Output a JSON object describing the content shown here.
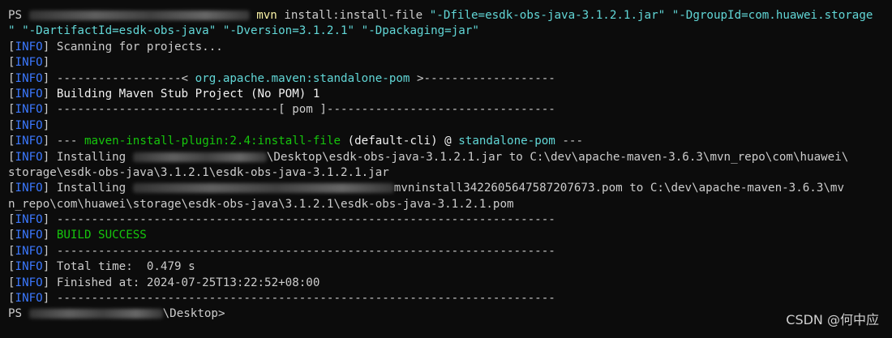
{
  "terminal": {
    "prompt_prefix": "PS",
    "command_line": {
      "cmd": "mvn",
      "rest": " install:install-file ",
      "arg1": "\"-Dfile=esdk-obs-java-3.1.2.1.jar\"",
      "arg2_start": "\"-DgroupId=com.huawei.storage",
      "arg2_end": "\"",
      "arg3": "\"-DartifactId=esdk-obs-java\"",
      "arg4": "\"-Dversion=3.1.2.1\"",
      "arg5": "\"-Dpackaging=jar\""
    },
    "info_tag": "INFO",
    "lines": {
      "scanning": "Scanning for projects...",
      "dash_left": "------------------< ",
      "artifact": "org.apache.maven:standalone-pom",
      "dash_right": " >-------------------",
      "building": "Building Maven Stub Project (No POM) 1",
      "pom_line": "--------------------------------[ pom ]---------------------------------",
      "plugin_dashes": "--- ",
      "plugin": "maven-install-plugin:2.4:install-file",
      "plugin_exec": " (default-cli) @ ",
      "plugin_project": "standalone-pom",
      "plugin_end": " ---",
      "installing_label": "Installing",
      "install1_path": "\\Desktop\\esdk-obs-java-3.1.2.1.jar to C:\\dev\\apache-maven-3.6.3\\mvn_repo\\com\\huawei\\",
      "install1_wrap": "storage\\esdk-obs-java\\3.1.2.1\\esdk-obs-java-3.1.2.1.jar",
      "install2_path": "mvninstall3422605647587207673.pom to C:\\dev\\apache-maven-3.6.3\\mv",
      "install2_wrap": "n_repo\\com\\huawei\\storage\\esdk-obs-java\\3.1.2.1\\esdk-obs-java-3.1.2.1.pom",
      "separator": "------------------------------------------------------------------------",
      "build_success": "BUILD SUCCESS",
      "total_time": "Total time:  0.479 s",
      "finished_at": "Finished at: 2024-07-25T13:22:52+08:00",
      "final_prompt_suffix": "\\Desktop>"
    }
  },
  "watermark": "CSDN @何中应"
}
